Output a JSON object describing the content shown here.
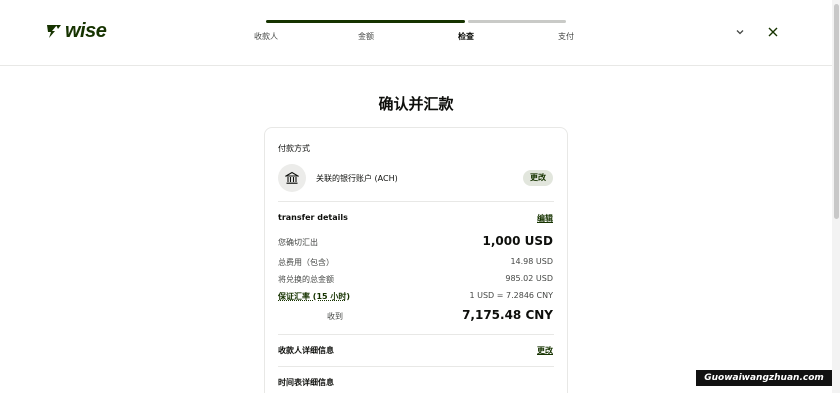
{
  "brand": {
    "name": "wise",
    "color": "#163300"
  },
  "progress": {
    "steps": [
      {
        "label": "收款人",
        "state": "done"
      },
      {
        "label": "金额",
        "state": "done"
      },
      {
        "label": "检查",
        "state": "current"
      },
      {
        "label": "支付",
        "state": "todo"
      }
    ]
  },
  "header": {
    "dropdown_icon": "chevron-down-icon",
    "close_icon": "close-icon"
  },
  "page": {
    "title": "确认并汇款"
  },
  "payment_method": {
    "section_label": "付款方式",
    "icon": "bank-icon",
    "method_label": "关联的银行账户 (ACH)",
    "change_label": "更改"
  },
  "transfer_details": {
    "title": "transfer details",
    "edit_label": "编辑",
    "rows": {
      "send_label": "您确切汇出",
      "send_value": "1,000 USD",
      "fee_label": "总费用（包含）",
      "fee_value": "14.98 USD",
      "convert_label": "将兑换的总金额",
      "convert_value": "985.02 USD",
      "rate_label": "保证汇率 (15 小时)",
      "rate_value": "1 USD = 7.2846 CNY",
      "receive_label": "收到",
      "receive_value": "7,175.48 CNY"
    }
  },
  "recipient": {
    "title": "收款人详细信息",
    "change_label": "更改"
  },
  "schedule": {
    "title": "时间表详细信息"
  },
  "watermark": {
    "text": "Guowaiwangzhuan.com"
  },
  "colors": {
    "accent": "#163300",
    "pill_bg": "#e2e6dd",
    "divider": "#e8e8e6"
  }
}
